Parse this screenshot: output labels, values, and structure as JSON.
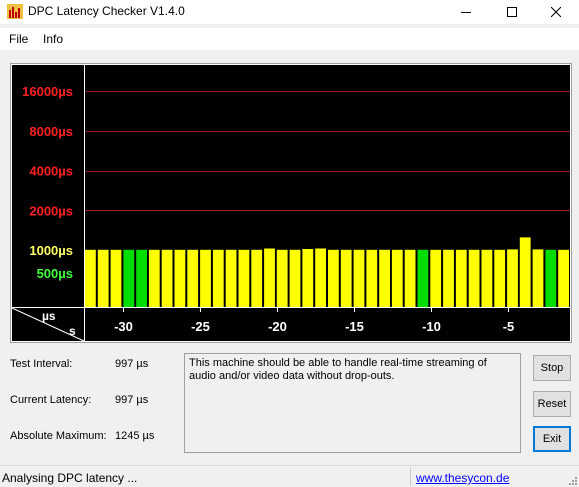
{
  "window": {
    "title": "DPC Latency Checker V1.4.0"
  },
  "menu": {
    "items": [
      "File",
      "Info"
    ]
  },
  "chart_data": {
    "type": "bar",
    "ylabel": "µs",
    "xlabel": "s",
    "y_tick_labels": [
      {
        "label": "16000µs",
        "value": 16000,
        "color": "#ff2020"
      },
      {
        "label": "8000µs",
        "value": 8000,
        "color": "#ff2020"
      },
      {
        "label": "4000µs",
        "value": 4000,
        "color": "#ff2020"
      },
      {
        "label": "2000µs",
        "value": 2000,
        "color": "#ff2020"
      },
      {
        "label": "1000µs",
        "value": 1000,
        "color": "#ffff60"
      },
      {
        "label": "500µs",
        "value": 500,
        "color": "#40ff40"
      }
    ],
    "x_tick_labels": [
      "-30",
      "-25",
      "-20",
      "-15",
      "-10",
      "-5"
    ],
    "x_ticks": [
      -30,
      -25,
      -20,
      -15,
      -10,
      -5
    ],
    "x_range": [
      -32.5,
      -1
    ],
    "values": [
      1004,
      1004,
      997,
      997,
      997,
      997,
      1004,
      1004,
      1004,
      1004,
      1004,
      1004,
      1004,
      1004,
      1026,
      1004,
      1004,
      1018,
      1026,
      1004,
      1004,
      1004,
      1004,
      997,
      997,
      1004,
      1004,
      1004,
      1004,
      997,
      997,
      1004,
      1004,
      1011,
      1245,
      1011,
      997,
      1004
    ],
    "bar_colors": [
      "yellow",
      "yellow",
      "yellow",
      "green",
      "green",
      "yellow",
      "yellow",
      "yellow",
      "yellow",
      "yellow",
      "yellow",
      "yellow",
      "yellow",
      "yellow",
      "yellow",
      "yellow",
      "yellow",
      "yellow",
      "yellow",
      "yellow",
      "yellow",
      "yellow",
      "yellow",
      "yellow",
      "yellow",
      "yellow",
      "green",
      "yellow",
      "yellow",
      "yellow",
      "yellow",
      "yellow",
      "yellow",
      "yellow",
      "yellow",
      "yellow",
      "green",
      "yellow"
    ],
    "colors": {
      "background": "#000000",
      "yellow": "#ffff00",
      "green": "#00dd00",
      "grid": "#9b1b1b",
      "axis": "#ffffff"
    }
  },
  "info": {
    "test_interval_label": "Test Interval:",
    "test_interval_value": "997 µs",
    "current_latency_label": "Current Latency:",
    "current_latency_value": "997 µs",
    "absolute_maximum_label": "Absolute Maximum:",
    "absolute_maximum_value": "1245 µs"
  },
  "message": "This machine should be able to handle real-time streaming of audio and/or video data without drop-outs.",
  "buttons": {
    "stop": "Stop",
    "reset": "Reset",
    "exit": "Exit"
  },
  "status": {
    "text": "Analysing DPC latency ...",
    "link": "www.thesycon.de"
  }
}
